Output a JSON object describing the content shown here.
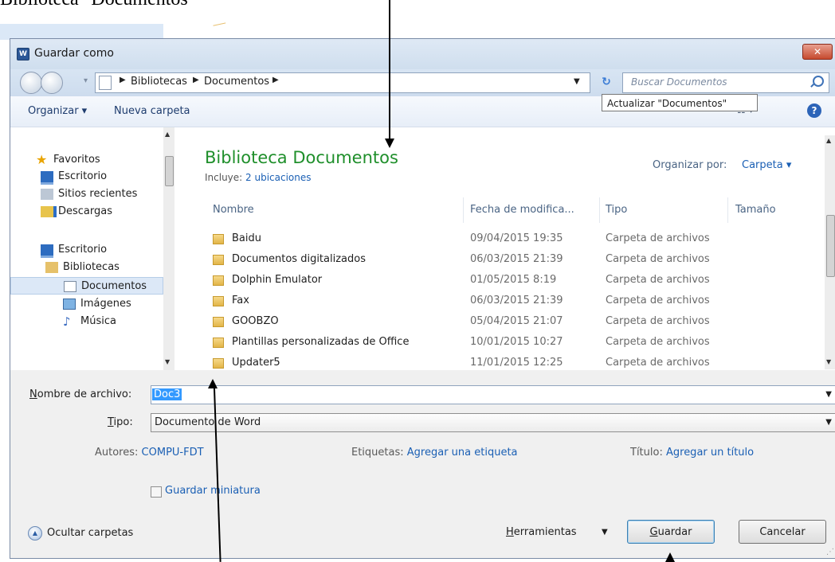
{
  "caption": "Biblioteca \"Documentos\"",
  "window": {
    "title": "Guardar como",
    "app_icon": "word-icon",
    "close_icon": "close-icon"
  },
  "address": {
    "crumbs": [
      "Bibliotecas",
      "Documentos"
    ],
    "search_placeholder": "Buscar Documentos",
    "refresh_tooltip": "Actualizar \"Documentos\""
  },
  "toolbar": {
    "organize": "Organizar ▾",
    "new_folder": "Nueva carpeta",
    "view_icon": "view-icon",
    "help": "?"
  },
  "nav": {
    "favorites": "Favoritos",
    "items": [
      "Escritorio",
      "Sitios recientes",
      "Descargas",
      "Escritorio",
      "Bibliotecas",
      "Documentos",
      "Imágenes",
      "Música"
    ]
  },
  "library": {
    "title": "Biblioteca Documentos",
    "includes_label": "Incluye:",
    "includes_link": "2 ubicaciones",
    "sort_label": "Organizar por:",
    "sort_value": "Carpeta ▾"
  },
  "columns": [
    "Nombre",
    "Fecha de modifica...",
    "Tipo",
    "Tamaño"
  ],
  "rows": [
    {
      "name": "Baidu",
      "date": "09/04/2015 19:35",
      "type": "Carpeta de archivos"
    },
    {
      "name": "Documentos digitalizados",
      "date": "06/03/2015 21:39",
      "type": "Carpeta de archivos"
    },
    {
      "name": "Dolphin Emulator",
      "date": "01/05/2015 8:19",
      "type": "Carpeta de archivos"
    },
    {
      "name": "Fax",
      "date": "06/03/2015 21:39",
      "type": "Carpeta de archivos"
    },
    {
      "name": "GOOBZO",
      "date": "05/04/2015 21:07",
      "type": "Carpeta de archivos"
    },
    {
      "name": "Plantillas personalizadas de Office",
      "date": "10/01/2015 10:27",
      "type": "Carpeta de archivos"
    },
    {
      "name": "Updater5",
      "date": "11/01/2015 12:25",
      "type": "Carpeta de archivos"
    }
  ],
  "form": {
    "filename_label_accel": "N",
    "filename_label_rest": "ombre de archivo:",
    "filename_value": "Doc3",
    "type_label_accel": "T",
    "type_label_rest": "ipo:",
    "type_value": "Documento de Word",
    "authors_label": "Autores:",
    "authors_value": "COMPU-FDT",
    "tags_label": "Etiquetas:",
    "tags_value": "Agregar una etiqueta",
    "title_label": "Título:",
    "title_value": "Agregar un título",
    "thumbnail_label": "Guardar miniatura"
  },
  "footer": {
    "hide_folders": "Ocultar carpetas",
    "tools_accel": "H",
    "tools_rest": "erramientas",
    "save_accel": "G",
    "save_rest": "uardar",
    "cancel": "Cancelar"
  }
}
